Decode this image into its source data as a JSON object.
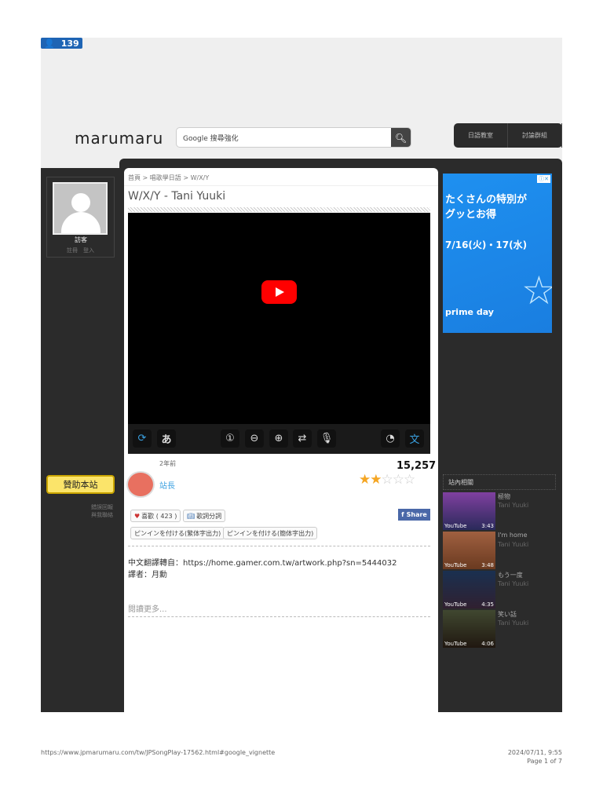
{
  "counter": "139",
  "header": {
    "logo": "marumaru",
    "search_placeholder": "Google 搜尋強化",
    "nav": [
      "日語教室",
      "討論群組"
    ]
  },
  "user": {
    "name": "訪客",
    "register": "註冊",
    "login": "登入"
  },
  "left": {
    "donate": "贊助本站",
    "report": "錯誤回報",
    "contact": "與我聯絡"
  },
  "breadcrumb": [
    "首頁",
    "唱歌學日語",
    "W/X/Y"
  ],
  "title": "W/X/Y - Tani Yuuki",
  "toolbar": {
    "kana": "あ",
    "one": "①"
  },
  "meta": {
    "time_ago": "2年前",
    "author": "站長",
    "views": "15,257",
    "rating": 2,
    "rating_max": 5
  },
  "buttons": {
    "like": "喜歡 ( 423 )",
    "lyrics": "歌詞分詞",
    "share": "Share",
    "pinyin_trad": "ピンインを付ける(繁体字出力)",
    "pinyin_simp": "ピンインを付ける(簡体字出力)"
  },
  "description": {
    "line1": "中文翻譯轉自：https://home.gamer.com.tw/artwork.php?sn=5444032",
    "line2": "譯者：月勳"
  },
  "read_more": "閱讀更多...",
  "ad": {
    "line1": "たくさんの特別が",
    "line2": "グッとお得",
    "dates": "7/16(火)・17(水)",
    "brand": "prime day"
  },
  "related": {
    "heading": "站內相關",
    "items": [
      {
        "title": "極物",
        "artist": "Tani Yuuki",
        "source": "YouTube",
        "duration": "3:43"
      },
      {
        "title": "I'm home",
        "artist": "Tani Yuuki",
        "source": "YouTube",
        "duration": "3:48"
      },
      {
        "title": "もう一度",
        "artist": "Tani Yuuki",
        "source": "YouTube",
        "duration": "4:35"
      },
      {
        "title": "笑い話",
        "artist": "Tani Yuuki",
        "source": "YouTube",
        "duration": "4:06"
      }
    ]
  },
  "footer": {
    "url": "https://www.jpmarumaru.com/tw/JPSongPlay-17562.html#google_vignette",
    "date": "2024/07/11, 9:55",
    "page": "Page 1 of 7"
  }
}
